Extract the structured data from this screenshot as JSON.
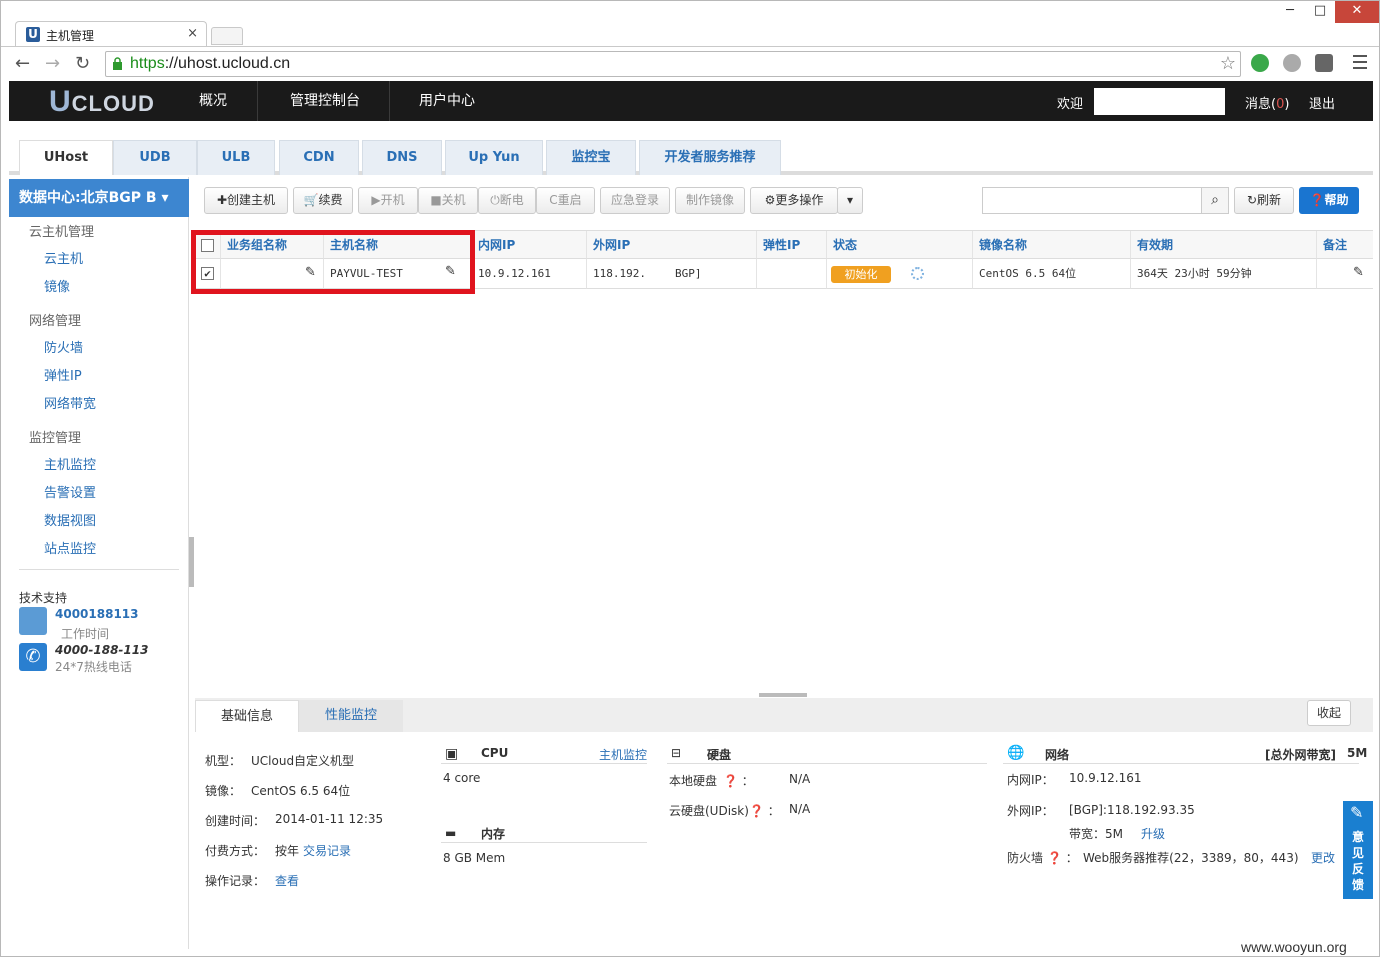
{
  "browser": {
    "tab_title": "主机管理",
    "url_scheme": "https",
    "url_rest": "://uhost.ucloud.cn",
    "win_min": "─",
    "win_max": "□",
    "win_close": "✕",
    "tab_close": "×"
  },
  "header": {
    "logo_u": "U",
    "logo_rest": "CLOUD",
    "nav": [
      "概况",
      "管理控制台",
      "用户中心"
    ],
    "welcome": "欢迎",
    "messages": "消息(",
    "messages_count": "0",
    "messages_close": ")",
    "logout": "退出"
  },
  "product_tabs": [
    "UHost",
    "UDB",
    "ULB",
    "CDN",
    "DNS",
    "Up Yun",
    "监控宝",
    "开发者服务推荐"
  ],
  "sidebar": {
    "datacenter": "数据中心:北京BGP B ▾",
    "groups": [
      {
        "title": "云主机管理",
        "items": [
          "云主机",
          "镜像"
        ]
      },
      {
        "title": "网络管理",
        "items": [
          "防火墙",
          "弹性IP",
          "网络带宽"
        ]
      },
      {
        "title": "监控管理",
        "items": [
          "主机监控",
          "告警设置",
          "数据视图",
          "站点监控"
        ]
      }
    ],
    "support_title": "技术支持",
    "qq_number": "4000188113",
    "qq_sub": "工作时间",
    "phone_number": "4000-188-113",
    "phone_sub": "24*7热线电话"
  },
  "toolbar": {
    "create": "✚创建主机",
    "renew": "续费",
    "start": "▶开机",
    "stop": "■关机",
    "poweroff": "⏻断电",
    "restart": "C重启",
    "emergency": "应急登录",
    "make_image": "制作镜像",
    "more": "更多操作",
    "refresh": "刷新",
    "help": "帮助",
    "search_placeholder": ""
  },
  "table": {
    "columns": [
      "业务组名称",
      "主机名称",
      "内网IP",
      "外网IP",
      "弹性IP",
      "状态",
      "镜像名称",
      "有效期",
      "备注"
    ],
    "rows": [
      {
        "checked": true,
        "group": "",
        "name": "PAYVUL-TEST",
        "inner_ip": "10.9.12.161",
        "outer_ip": "118.192.",
        "outer_ip_tag": "BGP]",
        "eip": "",
        "status": "初始化",
        "image": "CentOS 6.5 64位",
        "expires": "364天 23小时 59分钟",
        "remark": ""
      }
    ]
  },
  "detail": {
    "tabs": [
      "基础信息",
      "性能监控"
    ],
    "collapse": "收起",
    "basic": {
      "type_label": "机型：",
      "type_value": "UCloud自定义机型",
      "image_label": "镜像：",
      "image_value": "CentOS 6.5 64位",
      "created_label": "创建时间：",
      "created_value": "2014-01-11 12:35",
      "pay_label": "付费方式：",
      "pay_value": "按年",
      "pay_link": "交易记录",
      "ops_label": "操作记录：",
      "ops_link": "查看"
    },
    "cpu": {
      "title": "CPU",
      "link": "主机监控",
      "value": "4 core"
    },
    "mem": {
      "title": "内存",
      "value": "8 GB Mem"
    },
    "disk": {
      "title": "硬盘",
      "local_label": "本地硬盘",
      "local_value": "N/A",
      "cloud_label": "云硬盘(UDisk)",
      "cloud_value": "N/A"
    },
    "net": {
      "title": "网络",
      "bw_label": "[总外网带宽]",
      "bw_value": "5M",
      "inner_label": "内网IP：",
      "inner_value": "10.9.12.161",
      "outer_label": "外网IP：",
      "outer_value": "[BGP]:118.192.93.35",
      "band_label": "带宽：5M",
      "band_link": "升级",
      "fw_label": "防火墙",
      "fw_value": "Web服务器推荐(22，3389，80，443)",
      "fw_link": "更改"
    }
  },
  "feedback": "意见反馈",
  "watermark": "www.wooyun.org",
  "colors": {
    "accent": "#2a6fb5",
    "header_bg": "#1a1a1a",
    "status_orange": "#f0a020",
    "highlight_red": "#e0141e"
  }
}
